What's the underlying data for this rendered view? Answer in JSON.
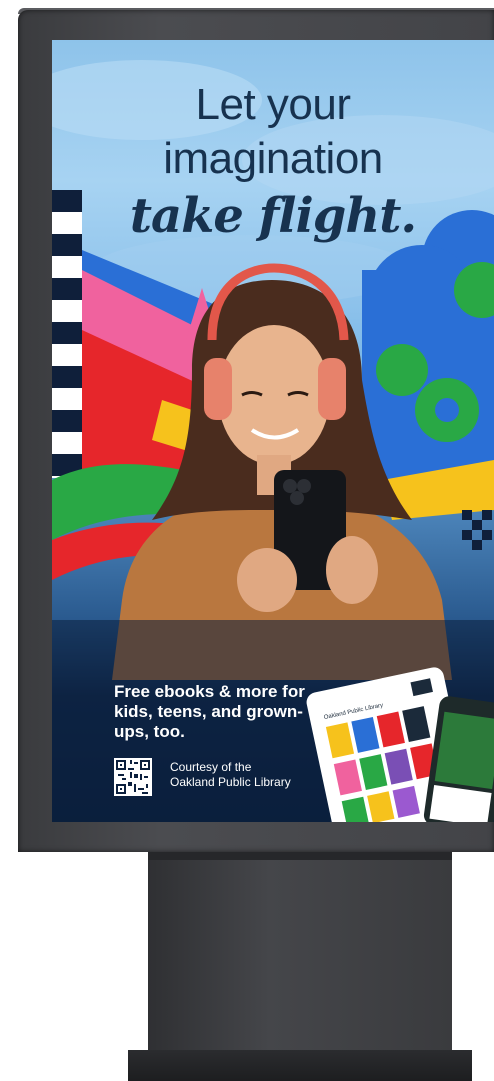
{
  "headline": {
    "line1": "Let your",
    "line2": "imagination",
    "line3": "take flight."
  },
  "tagline": "Free ebooks & more for kids, teens, and grown-ups, too.",
  "courtesy": {
    "line1": "Courtesy of the",
    "line2": "Oakland Public Library"
  },
  "app_screen": {
    "library_name": "Oakland Public Library"
  },
  "colors": {
    "headline": "#17324f",
    "sky": "#8ec3ea",
    "poster_bottom": "#0b1f3d",
    "pink": "#f0629e",
    "red": "#e6262b",
    "green": "#29a845",
    "blue": "#2a6fd6"
  }
}
